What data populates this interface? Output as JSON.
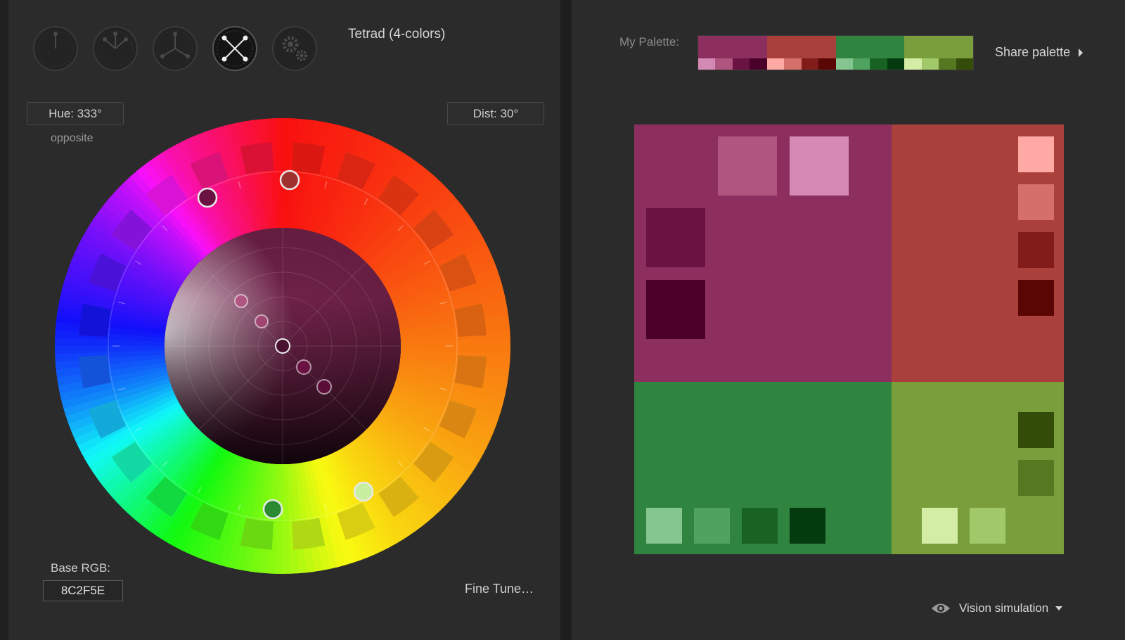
{
  "scheme": {
    "title": "Tetrad (4-colors)",
    "buttons": [
      {
        "name": "mono",
        "active": false
      },
      {
        "name": "complement",
        "active": false
      },
      {
        "name": "triad",
        "active": false
      },
      {
        "name": "tetrad",
        "active": true
      },
      {
        "name": "free",
        "active": false
      }
    ]
  },
  "wheel_controls": {
    "hue_label": "Hue: 333°",
    "dist_label": "Dist: 30°",
    "opposite_label": "opposite",
    "base_rgb_label": "Base RGB:",
    "base_rgb_value": "8C2F5E",
    "fine_tune_label": "Fine Tune…"
  },
  "palette": {
    "label": "My Palette:",
    "share_label": "Share palette",
    "colors": [
      {
        "main": "#8C2F5E",
        "shades": [
          "#D58AB5",
          "#B0557F",
          "#6A1242",
          "#4A0028"
        ]
      },
      {
        "main": "#AA403C",
        "shades": [
          "#FFA9A5",
          "#D46F69",
          "#821C1A",
          "#5A0605"
        ]
      },
      {
        "main": "#2F843F",
        "shades": [
          "#85C58F",
          "#4FA35E",
          "#186222",
          "#033B0E"
        ]
      },
      {
        "main": "#7A9E3C",
        "shades": [
          "#D3EDA6",
          "#A2C969",
          "#557921",
          "#334C07"
        ]
      }
    ]
  },
  "vision": {
    "label": "Vision simulation"
  }
}
